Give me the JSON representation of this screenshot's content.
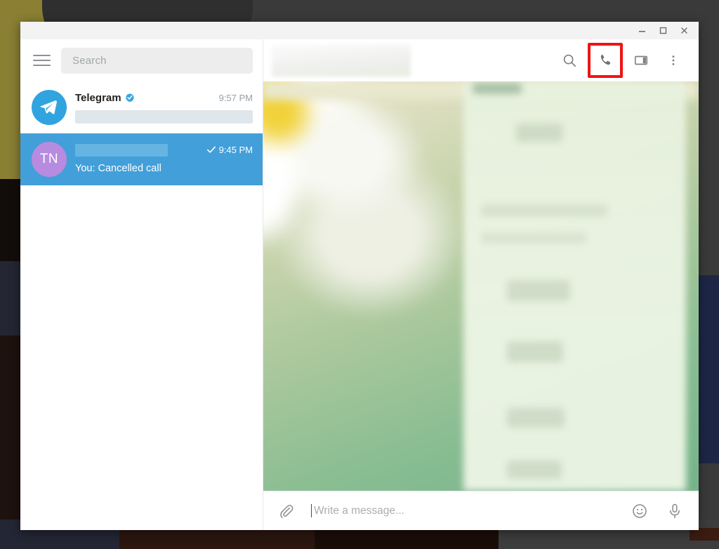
{
  "window": {
    "controls": [
      {
        "name": "minimize",
        "label": "Minimize"
      },
      {
        "name": "maximize",
        "label": "Maximize"
      },
      {
        "name": "close",
        "label": "Close"
      }
    ]
  },
  "sidebar": {
    "menu_button_label": "Menu",
    "search": {
      "placeholder": "Search",
      "value": ""
    },
    "chats": [
      {
        "avatar_type": "telegram-logo",
        "avatar_initials": "",
        "avatar_color": "#31a4df",
        "title": "Telegram",
        "verified": true,
        "time": "9:57 PM",
        "preview": "",
        "preview_redacted": true,
        "name_redacted": false,
        "read_check": false,
        "selected": false
      },
      {
        "avatar_type": "initials",
        "avatar_initials": "TN",
        "avatar_color": "#b78be0",
        "title": "",
        "verified": false,
        "time": "9:45 PM",
        "preview": "You: Cancelled call",
        "preview_redacted": false,
        "name_redacted": true,
        "read_check": true,
        "selected": true
      }
    ]
  },
  "conversation": {
    "header": {
      "title_redacted": true,
      "actions": [
        {
          "name": "search-icon",
          "label": "Search messages",
          "highlighted": false
        },
        {
          "name": "phone-icon",
          "label": "Call",
          "highlighted": true
        },
        {
          "name": "sidebar-toggle-icon",
          "label": "Toggle info panel",
          "highlighted": false
        },
        {
          "name": "more-vertical-icon",
          "label": "More options",
          "highlighted": false
        }
      ],
      "highlight_color": "#f01414"
    },
    "wallpaper_description": "blurred daisy flower photo wallpaper",
    "messages_redacted": true
  },
  "composer": {
    "attach_label": "Attach file",
    "input": {
      "placeholder": "Write a message...",
      "value": ""
    },
    "emoji_label": "Emoji",
    "mic_label": "Record voice message"
  },
  "colors": {
    "accent": "#31a4df",
    "selected_row": "#429fd9",
    "highlight": "#f01414",
    "avatar_purple": "#b78be0"
  }
}
